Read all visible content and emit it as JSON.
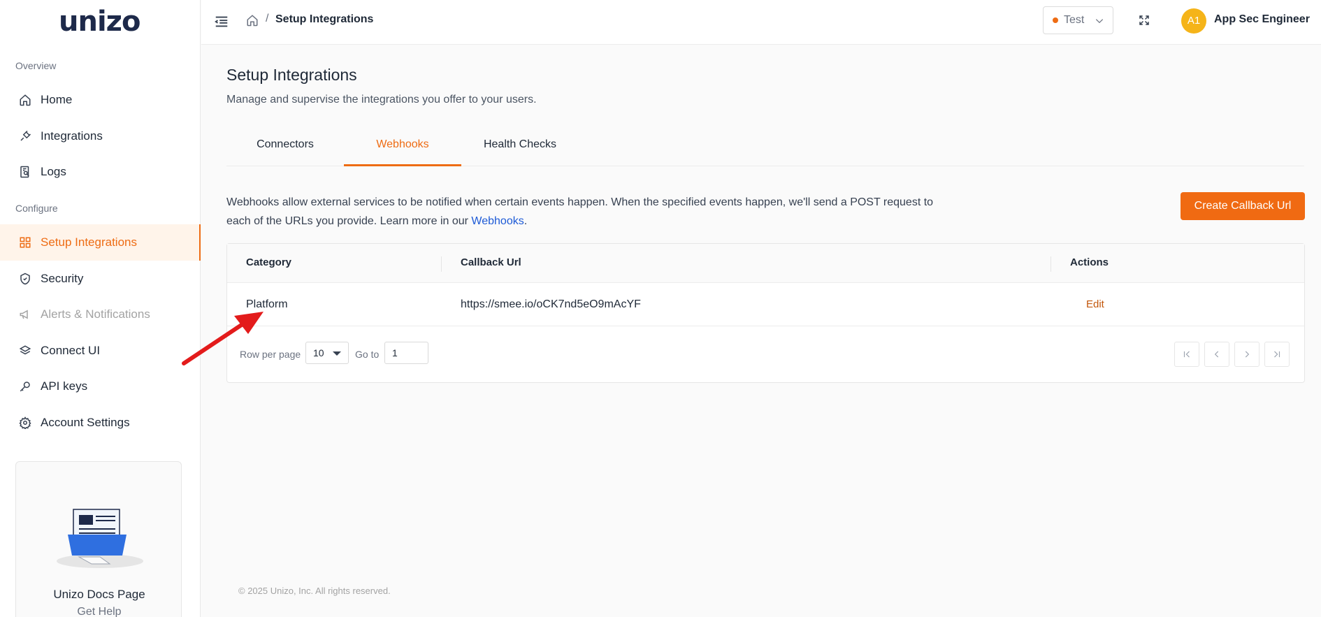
{
  "brand": {
    "logo_text": "unizo"
  },
  "sidebar": {
    "sections": [
      {
        "label": "Overview"
      },
      {
        "label": "Configure"
      }
    ],
    "items": [
      {
        "label": "Home",
        "icon": "home-icon"
      },
      {
        "label": "Integrations",
        "icon": "plug-icon"
      },
      {
        "label": "Logs",
        "icon": "log-search-icon"
      },
      {
        "label": "Setup Integrations",
        "icon": "grid-icon",
        "active": true
      },
      {
        "label": "Security",
        "icon": "shield-icon"
      },
      {
        "label": "Alerts & Notifications",
        "icon": "megaphone-icon",
        "disabled": true
      },
      {
        "label": "Connect UI",
        "icon": "layers-icon"
      },
      {
        "label": "API keys",
        "icon": "key-icon"
      },
      {
        "label": "Account Settings",
        "icon": "gear-icon"
      }
    ],
    "docs_card": {
      "title": "Unizo Docs Page",
      "subtitle": "Get Help"
    }
  },
  "header": {
    "breadcrumb": {
      "separator": "/",
      "current": "Setup Integrations"
    },
    "environment": {
      "value": "Test",
      "status_color": "#ee6c14"
    },
    "user": {
      "initials": "A1",
      "name": "App Sec Engineer"
    }
  },
  "main": {
    "title": "Setup Integrations",
    "subtitle": "Manage and supervise the integrations you offer to your users.",
    "tabs": [
      {
        "label": "Connectors"
      },
      {
        "label": "Webhooks",
        "active": true
      },
      {
        "label": "Health Checks"
      }
    ],
    "description_text": "Webhooks allow external services to be notified when certain events happen. When the specified events happen, we'll send a POST request to each of the URLs you provide. Learn more in our ",
    "description_link": "Webhooks",
    "description_end": ".",
    "create_button": "Create Callback Url",
    "table": {
      "headers": {
        "category": "Category",
        "callback_url": "Callback Url",
        "actions": "Actions"
      },
      "rows": [
        {
          "category": "Platform",
          "callback_url": "https://smee.io/oCK7nd5eO9mAcYF",
          "action": "Edit"
        }
      ]
    },
    "pagination": {
      "rows_label": "Row per page",
      "rows_value": "10",
      "goto_label": "Go to",
      "goto_value": "1"
    }
  },
  "footer": {
    "text": "© 2025 Unizo, Inc. All rights reserved."
  },
  "colors": {
    "accent": "#ee6c14",
    "link": "#1d5ad6",
    "annotation_arrow": "#e31b1b"
  }
}
